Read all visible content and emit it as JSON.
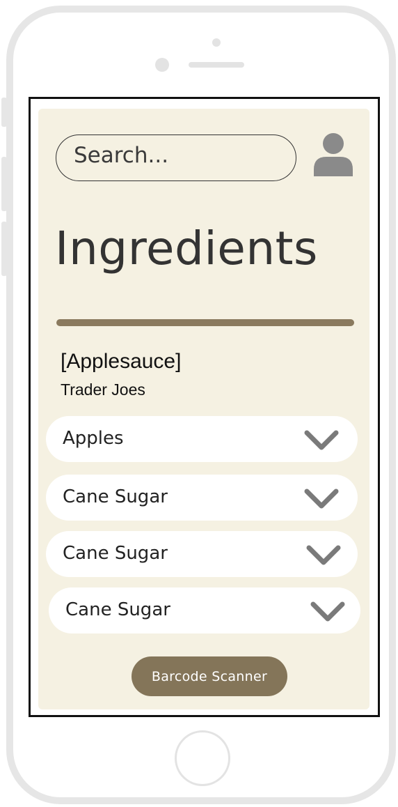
{
  "search": {
    "placeholder": "Search..."
  },
  "page": {
    "title": "Ingredients"
  },
  "product": {
    "name": "[Applesauce]",
    "store": "Trader Joes"
  },
  "ingredients": [
    {
      "label": "Apples"
    },
    {
      "label": "Cane Sugar"
    },
    {
      "label": "Cane Sugar"
    },
    {
      "label": "Cane Sugar"
    }
  ],
  "actions": {
    "scan_label": "Barcode Scanner"
  },
  "icons": {
    "profile": "user-avatar-icon",
    "expand": "chevron-down-icon"
  },
  "colors": {
    "background": "#f5f1e2",
    "accent": "#847559",
    "divider": "#8a7a5e"
  }
}
